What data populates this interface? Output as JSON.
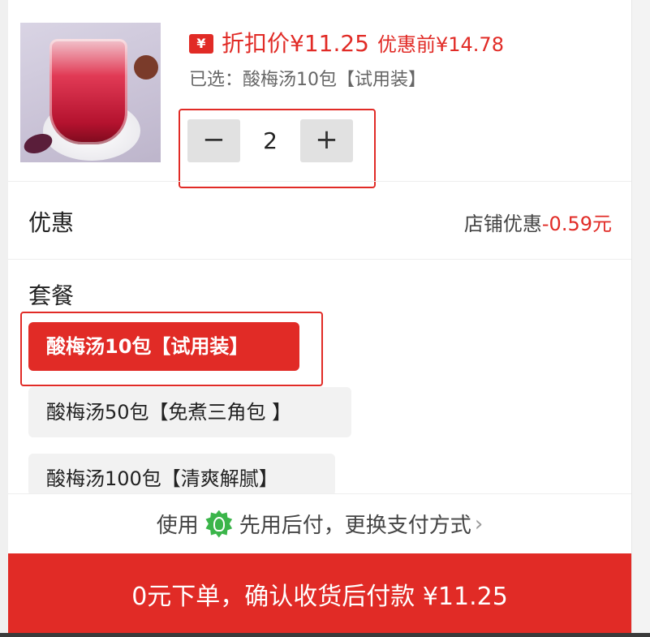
{
  "product": {
    "price_badge": "¥",
    "price_label": "折扣价",
    "price_value": "¥11.25",
    "original_price": "优惠前¥14.78",
    "selected_text": "已选：酸梅汤10包【试用装】"
  },
  "quantity": {
    "minus": "−",
    "value": "2",
    "plus": "+"
  },
  "promotion": {
    "title": "优惠",
    "detail_label": "店铺优惠",
    "detail_amount": "-0.59元"
  },
  "packages": {
    "title": "套餐",
    "options": [
      {
        "label": "酸梅汤10包【试用装】",
        "selected": true
      },
      {
        "label": "酸梅汤50包【免煮三角包 】",
        "selected": false
      },
      {
        "label": "酸梅汤100包【清爽解腻】",
        "selected": false
      }
    ]
  },
  "payment": {
    "prefix": "使用",
    "method": "先用后付，更换支付方式",
    "chevron": "›",
    "icon": "green-badge-icon"
  },
  "cta": {
    "label": "0元下单，确认收货后付款 ¥11.25"
  },
  "colors": {
    "accent": "#e12b26",
    "option_bg": "#f2f2f2",
    "stepper_bg": "#e1e1e1",
    "pay_icon": "#3bb54a"
  }
}
